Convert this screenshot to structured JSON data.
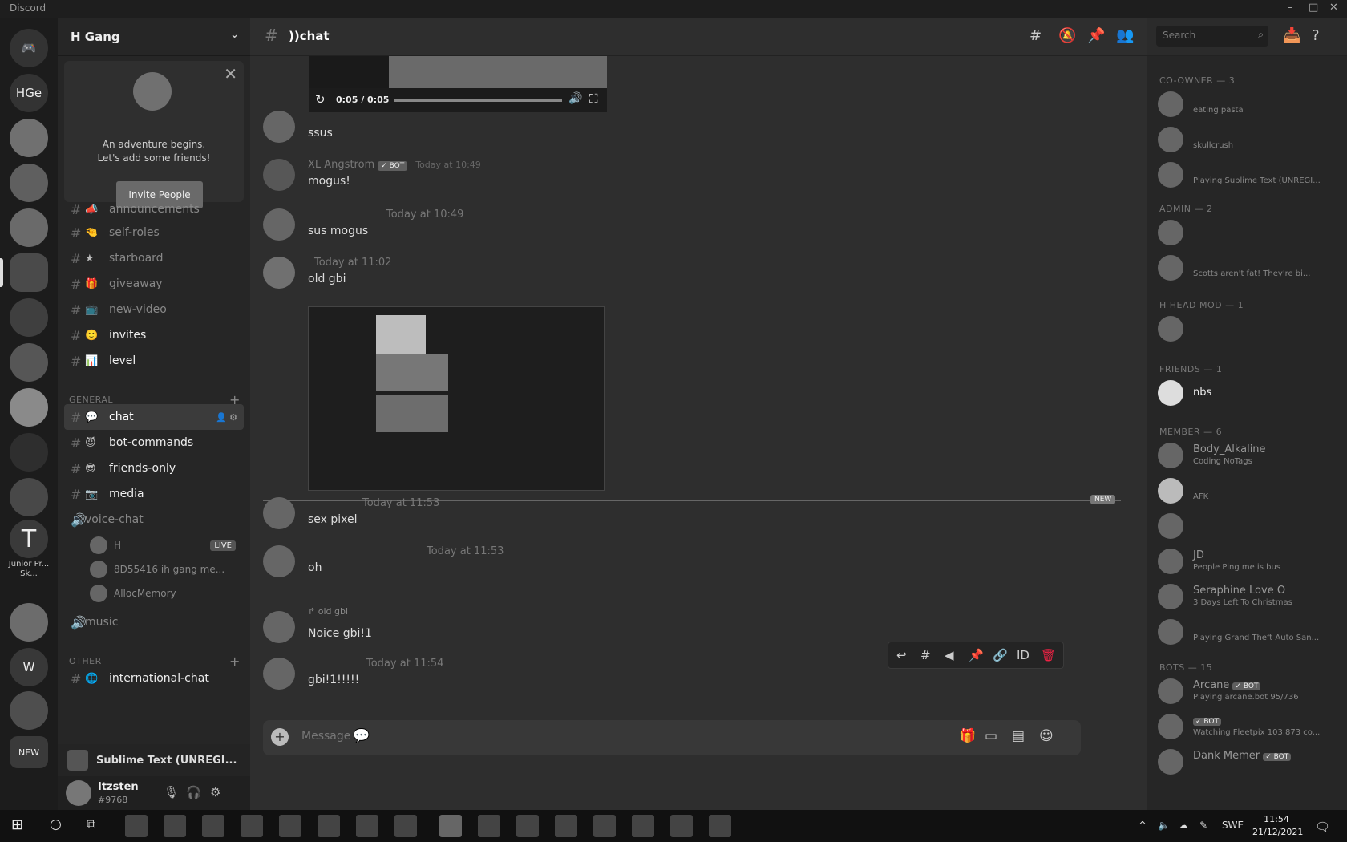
{
  "window": {
    "title": "Discord"
  },
  "guilds": {
    "home_label": "HGe",
    "caption": "Junior Pr... Sk...",
    "w_label": "W",
    "new_label": "NEW"
  },
  "server": {
    "name": "H Gang"
  },
  "invite_popup": {
    "line1": "An adventure begins.",
    "line2": "Let's add some friends!",
    "button": "Invite People"
  },
  "channels": [
    {
      "name": "announcements",
      "emoji": "📣"
    },
    {
      "name": "self-roles",
      "emoji": "🤏"
    },
    {
      "name": "starboard",
      "emoji": "★"
    },
    {
      "name": "giveaway",
      "emoji": "🎁"
    },
    {
      "name": "new-video",
      "emoji": "📺"
    },
    {
      "name": "invites",
      "emoji": "🙂"
    },
    {
      "name": "level",
      "emoji": "📊"
    }
  ],
  "categories": {
    "general": "GENERAL",
    "other": "OTHER"
  },
  "general_channels": [
    {
      "name": "chat",
      "emoji": "💬"
    },
    {
      "name": "bot-commands",
      "emoji": "😈"
    },
    {
      "name": "friends-only",
      "emoji": "😎"
    },
    {
      "name": "media",
      "emoji": "📷"
    }
  ],
  "voice": {
    "channel": "voice-chat",
    "users": [
      "H",
      "8D55416 ih gang me...",
      "AllocMemory"
    ],
    "live": "LIVE",
    "music": "music"
  },
  "other_channels": [
    {
      "name": "international-chat",
      "emoji": "🌐"
    }
  ],
  "activity": {
    "label": "Sublime Text (UNREGI..."
  },
  "user": {
    "name": "Itzsten",
    "tag": "#9768"
  },
  "header": {
    "channel": "))chat",
    "search_placeholder": "Search"
  },
  "video": {
    "time": "0:05 / 0:05"
  },
  "messages": [
    {
      "author": "",
      "time": "",
      "body": "ssus"
    },
    {
      "author": "XL Angstrom",
      "bot": "✓ BOT",
      "time": "Today at 10:49",
      "body": "mogus!"
    },
    {
      "author": "",
      "time": "Today at 10:49",
      "body": "sus mogus"
    },
    {
      "author": "",
      "time": "Today at 11:02",
      "body": "old gbi"
    },
    {
      "author": "",
      "time": "Today at 11:53",
      "body": "sex pixel"
    },
    {
      "author": "",
      "time": "Today at 11:53",
      "body": "oh"
    },
    {
      "author": "",
      "time": "",
      "body": "Noice gbi!1",
      "reply_to": "old gbi"
    },
    {
      "author": "",
      "time": "Today at 11:54",
      "body": "gbi!1!!!!!"
    }
  ],
  "new_marker": "NEW",
  "composer": {
    "placeholder": "Message"
  },
  "members": {
    "categories": [
      "CO-OWNER — 3",
      "ADMIN — 2",
      "H HEAD MOD — 1",
      "FRIENDS — 1",
      "MEMBER — 6",
      "BOTS — 15"
    ],
    "list": [
      {
        "name": "",
        "status": "eating pasta"
      },
      {
        "name": "",
        "status": "skullcrush"
      },
      {
        "name": "",
        "status": "Playing Sublime Text (UNREGI..."
      },
      {
        "name": "",
        "status": ""
      },
      {
        "name": "",
        "status": "Scotts aren't fat! They're bi..."
      },
      {
        "name": "",
        "status": ""
      },
      {
        "name": "nbs",
        "status": ""
      },
      {
        "name": "Body_Alkaline",
        "status": "Coding NoTags"
      },
      {
        "name": "",
        "status": "AFK"
      },
      {
        "name": "",
        "status": ""
      },
      {
        "name": "JD",
        "status": "People Ping me is bus"
      },
      {
        "name": "Seraphine Love O",
        "status": "3 Days Left To Christmas"
      },
      {
        "name": "",
        "status": "Playing Grand Theft Auto San..."
      },
      {
        "name": "Arcane",
        "status": "Playing arcane.bot 95/736",
        "bot": "✓ BOT"
      },
      {
        "name": "",
        "status": "Watching Fleetpix 103.873 co...",
        "bot": "✓ BOT"
      },
      {
        "name": "Dank Memer",
        "status": "",
        "bot": "✓ BOT"
      }
    ]
  },
  "taskbar": {
    "lang": "SWE",
    "time": "11:54",
    "date": "21/12/2021"
  }
}
